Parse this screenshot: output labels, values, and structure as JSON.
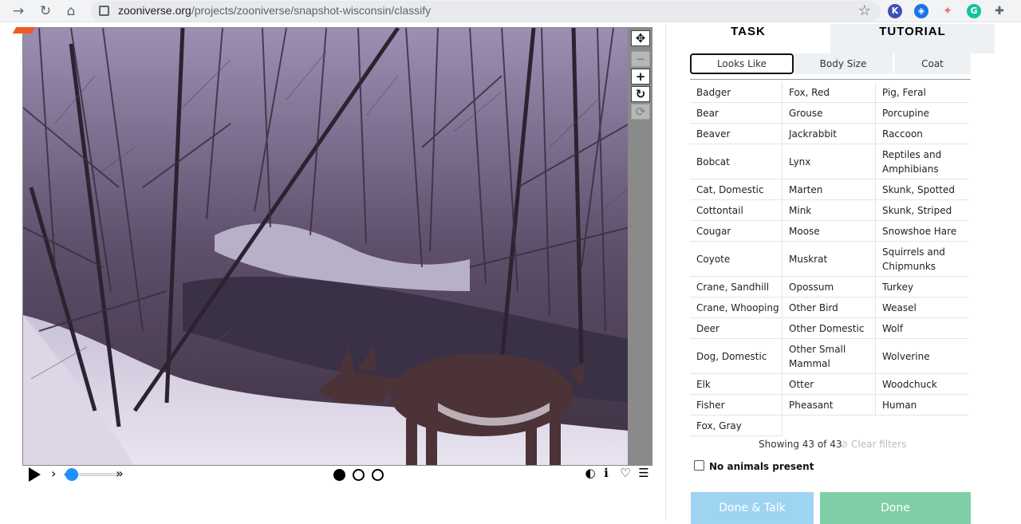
{
  "browser": {
    "url_host": "zooniverse.org",
    "url_path": "/projects/zooniverse/snapshot-wisconsin/classify",
    "extensions": [
      {
        "icon": "k-extension-icon",
        "label": "K",
        "color": "#3f51b5"
      },
      {
        "icon": "shield-extension-icon",
        "label": "",
        "color": "#1a73e8"
      },
      {
        "icon": "puzzle-badge-extension-icon",
        "label": "",
        "color": "#e57373"
      },
      {
        "icon": "grammarly-extension-icon",
        "label": "G",
        "color": "#15c39a"
      },
      {
        "icon": "extensions-puzzle-icon",
        "label": "",
        "color": "#5f6368"
      }
    ]
  },
  "viewer": {
    "tools": [
      "move-icon",
      "zoom-out-icon",
      "zoom-in-icon",
      "rotate-icon",
      "reset-icon"
    ],
    "frames": {
      "count": 3,
      "active": 0
    },
    "speed_slider_fraction": 0.15
  },
  "panel": {
    "tabs": {
      "task": "TASK",
      "tutorial": "TUTORIAL"
    },
    "filters": [
      "Looks Like",
      "Body Size",
      "Coat"
    ],
    "active_filter": 0,
    "choices": [
      [
        "Badger",
        "Fox, Red",
        "Pig, Feral"
      ],
      [
        "Bear",
        "Grouse",
        "Porcupine"
      ],
      [
        "Beaver",
        "Jackrabbit",
        "Raccoon"
      ],
      [
        "Bobcat",
        "Lynx",
        "Reptiles and Amphibians"
      ],
      [
        "Cat, Domestic",
        "Marten",
        "Skunk, Spotted"
      ],
      [
        "Cottontail",
        "Mink",
        "Skunk, Striped"
      ],
      [
        "Cougar",
        "Moose",
        "Snowshoe Hare"
      ],
      [
        "Coyote",
        "Muskrat",
        "Squirrels and Chipmunks"
      ],
      [
        "Crane, Sandhill",
        "Opossum",
        "Turkey"
      ],
      [
        "Crane, Whooping",
        "Other Bird",
        "Weasel"
      ],
      [
        "Deer",
        "Other Domestic",
        "Wolf"
      ],
      [
        "Dog, Domestic",
        "Other Small Mammal",
        "Wolverine"
      ],
      [
        "Elk",
        "Otter",
        "Woodchuck"
      ],
      [
        "Fisher",
        "Pheasant",
        "Human"
      ],
      [
        "Fox, Gray"
      ]
    ],
    "showing": "Showing 43 of 43",
    "clear_filters": "Clear filters",
    "no_animals": "No animals present",
    "buttons": {
      "done_talk": "Done & Talk",
      "done": "Done"
    }
  }
}
